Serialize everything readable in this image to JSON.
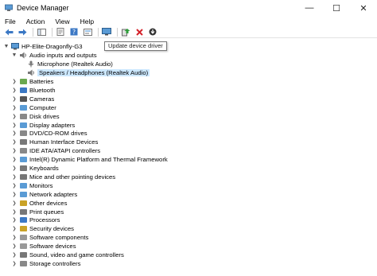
{
  "window": {
    "title": "Device Manager",
    "controls": {
      "minimize": "—",
      "maximize": "☐",
      "close": "✕"
    }
  },
  "menu": [
    "File",
    "Action",
    "View",
    "Help"
  ],
  "toolbar": {
    "buttons": [
      "back-icon",
      "forward-icon",
      "console-tree-icon",
      "properties-icon",
      "help-icon",
      "show-hide-icon",
      "monitor-icon",
      "update-driver-icon",
      "uninstall-icon",
      "download-icon"
    ]
  },
  "tooltip": "Update device driver",
  "tree": {
    "root": "HP-Elite-Dragonfly-G3",
    "expanded_category": "Audio inputs and outputs",
    "children": [
      "Microphone (Realtek Audio)",
      "Speakers / Headphones (Realtek Audio)"
    ],
    "selected": "Speakers / Headphones (Realtek Audio)",
    "categories": [
      "Batteries",
      "Bluetooth",
      "Cameras",
      "Computer",
      "Disk drives",
      "Display adapters",
      "DVD/CD-ROM drives",
      "Human Interface Devices",
      "IDE ATA/ATAPI controllers",
      "Intel(R) Dynamic Platform and Thermal Framework",
      "Keyboards",
      "Mice and other pointing devices",
      "Monitors",
      "Network adapters",
      "Other devices",
      "Print queues",
      "Processors",
      "Security devices",
      "Software components",
      "Software devices",
      "Sound, video and game controllers",
      "Storage controllers"
    ]
  },
  "colors": {
    "selection": "#cce8ff",
    "folder": "#4a90d9"
  }
}
